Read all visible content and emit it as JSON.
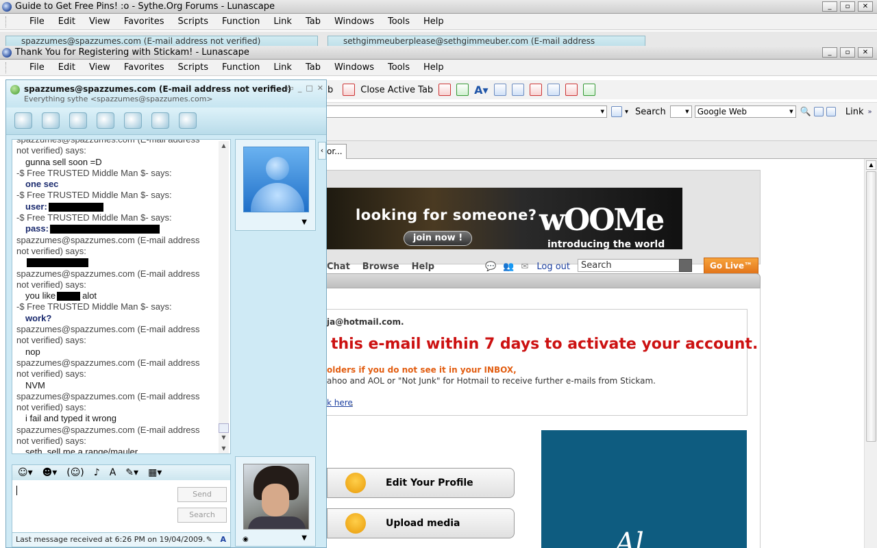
{
  "back_window": {
    "title": "Guide to Get Free Pins! :o - Sythe.Org Forums - Lunascape",
    "menu": [
      "File",
      "Edit",
      "View",
      "Favorites",
      "Scripts",
      "Function",
      "Link",
      "Tab",
      "Windows",
      "Tools",
      "Help"
    ],
    "mdi_tabs": [
      "spazzumes@spazzumes.com (E-mail address not verified)",
      "sethgimmeuberplease@sethgimmeuber.com (E-mail address"
    ]
  },
  "front_window": {
    "title": "Thank You for Registering with Stickam! - Lunascape",
    "menu": [
      "File",
      "Edit",
      "View",
      "Favorites",
      "Scripts",
      "Function",
      "Link",
      "Tab",
      "Windows",
      "Tools",
      "Help"
    ],
    "toolbar": {
      "close_active_tab": "Close Active Tab",
      "partial_label": "b"
    },
    "address": {
      "search_label": "Search",
      "engine": "Google Web",
      "link_label": "Link"
    },
    "tab_label": "or..."
  },
  "page": {
    "ad": {
      "headline": "looking for someone?",
      "button": "join now !",
      "logo": "wOOMe",
      "tagline": "introducing the world"
    },
    "nav": [
      "Chat",
      "Browse",
      "Help"
    ],
    "logout": "Log out",
    "search_placeholder": "Search",
    "golive": "Go Live™",
    "email": "ja@hotmail.com.",
    "headline": "this e-mail within 7 days to activate your account.",
    "orange_line": "olders if you do not see it in your INBOX,",
    "info_line": "ahoo and AOL or \"Not Junk\" for Hotmail to receive further e-mails from Stickam.",
    "click_link": "k here",
    "click_suffix": ".",
    "buttons": [
      "Edit Your Profile",
      "Upload media"
    ]
  },
  "messenger": {
    "title": "spazzumes@spazzumes.com (E-mail address not verified)",
    "subtitle": "Everything sythe <spazzumes@spazzumes.com>",
    "lines": [
      {
        "t": "h",
        "text": "spazzumes@spazzumes.com (E-mail address"
      },
      {
        "t": "h",
        "text": "not verified) says:"
      },
      {
        "t": "m",
        "text": "gunna sell soon =D"
      },
      {
        "t": "h",
        "text": "-$  Free TRUSTED Middle Man  $- says:"
      },
      {
        "t": "b",
        "text": "one sec"
      },
      {
        "t": "h",
        "text": "-$  Free TRUSTED Middle Man  $- says:"
      },
      {
        "t": "b",
        "text": "user:",
        "redact": 80
      },
      {
        "t": "h",
        "text": "-$  Free TRUSTED Middle Man  $- says:"
      },
      {
        "t": "b",
        "text": "pass:",
        "redact": 160
      },
      {
        "t": "h",
        "text": "spazzumes@spazzumes.com (E-mail address"
      },
      {
        "t": "h",
        "text": "not verified) says:"
      },
      {
        "t": "m",
        "text": "",
        "redact": 90
      },
      {
        "t": "h",
        "text": "spazzumes@spazzumes.com (E-mail address"
      },
      {
        "t": "h",
        "text": "not verified) says:"
      },
      {
        "t": "m",
        "text": "you like",
        "redact": 34,
        "after": "alot"
      },
      {
        "t": "h",
        "text": "-$  Free TRUSTED Middle Man  $- says:"
      },
      {
        "t": "b",
        "text": "work?"
      },
      {
        "t": "h",
        "text": "spazzumes@spazzumes.com (E-mail address"
      },
      {
        "t": "h",
        "text": "not verified) says:"
      },
      {
        "t": "m",
        "text": "nop"
      },
      {
        "t": "h",
        "text": "spazzumes@spazzumes.com (E-mail address"
      },
      {
        "t": "h",
        "text": "not verified) says:"
      },
      {
        "t": "m",
        "text": "NVM"
      },
      {
        "t": "h",
        "text": "spazzumes@spazzumes.com (E-mail address"
      },
      {
        "t": "h",
        "text": "not verified) says:"
      },
      {
        "t": "m",
        "text": "i fail and typed it wrong"
      },
      {
        "t": "h",
        "text": "spazzumes@spazzumes.com (E-mail address"
      },
      {
        "t": "h",
        "text": "not verified) says:"
      },
      {
        "t": "m",
        "text": "seth..sell me a range/mauler"
      }
    ],
    "send": "Send",
    "search": "Search",
    "status": "Last message received at 6:26 PM on 19/04/2009."
  }
}
